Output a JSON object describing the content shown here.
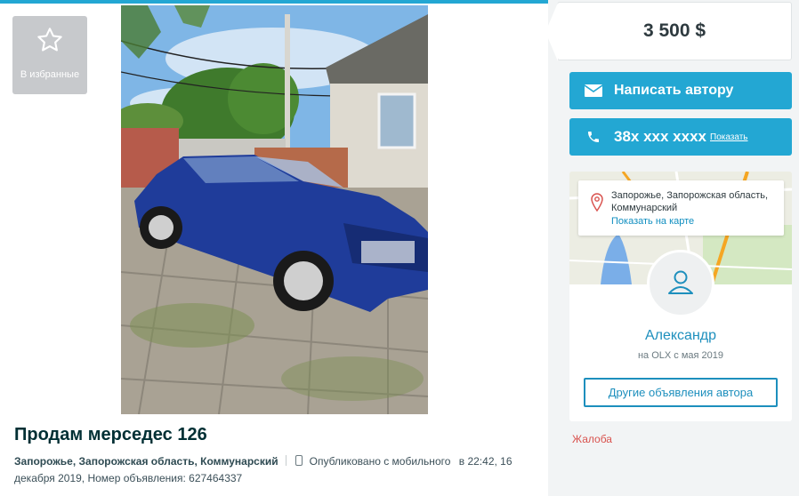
{
  "favorites": {
    "label": "В избранные",
    "icon": "star-icon"
  },
  "ad": {
    "title": "Продам мерседес 126",
    "location": "Запорожье, Запорожская область, Коммунарский",
    "published_prefix": "Опубликовано с мобильного",
    "published_when": "в 22:42, 16 декабря 2019, Номер объявления: 627464337"
  },
  "price": "3 500 $",
  "actions": {
    "message_label": "Написать автору",
    "phone_number": "38x xxx xxxx",
    "phone_show": "Показать"
  },
  "location_popup": {
    "address": "Запорожье, Запорожская область, Коммунарский",
    "map_link": "Показать на карте"
  },
  "seller": {
    "name": "Александр",
    "since": "на OLX с мая 2019",
    "other_ads_label": "Другие объявления автора"
  },
  "complain_label": "Жалоба",
  "colors": {
    "accent": "#23a7d3",
    "link": "#1d8fbd",
    "complain": "#d9534f",
    "car_blue": "#1f3c9a"
  }
}
